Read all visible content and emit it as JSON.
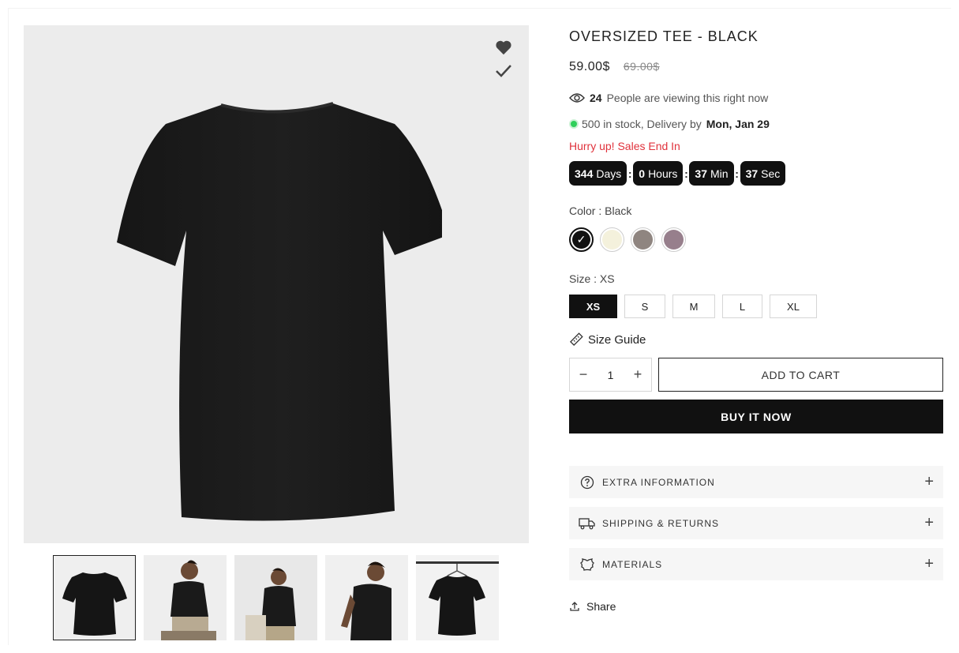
{
  "product": {
    "title": "OVERSIZED TEE - BLACK",
    "price": "59.00$",
    "compare_price": "69.00$"
  },
  "social_proof": {
    "viewers_count": "24",
    "viewers_text": "People are viewing this right now"
  },
  "stock": {
    "text": "500 in stock, Delivery by",
    "date": "Mon, Jan 29"
  },
  "countdown": {
    "hurry_text": "Hurry up! Sales End In",
    "days_value": "344",
    "days_label": "Days",
    "hours_value": "0",
    "hours_label": "Hours",
    "min_value": "37",
    "min_label": "Min",
    "sec_value": "37",
    "sec_label": "Sec",
    "separator": ":"
  },
  "color": {
    "label": "Color : Black",
    "options": [
      {
        "name": "Black",
        "hex": "#111111",
        "selected": true
      },
      {
        "name": "Cream",
        "hex": "#f4f1dc",
        "selected": false
      },
      {
        "name": "Taupe",
        "hex": "#8f8580",
        "selected": false
      },
      {
        "name": "Mauve",
        "hex": "#977f8c",
        "selected": false
      }
    ]
  },
  "size": {
    "label": "Size : XS",
    "options": [
      "XS",
      "S",
      "M",
      "L",
      "XL"
    ],
    "selected": "XS"
  },
  "size_guide": "Size Guide",
  "quantity": {
    "minus": "−",
    "value": "1",
    "plus": "+"
  },
  "buttons": {
    "add_to_cart": "ADD TO CART",
    "buy_now": "BUY IT NOW"
  },
  "accordion": {
    "extra": "EXTRA INFORMATION",
    "shipping": "SHIPPING & RETURNS",
    "materials": "MATERIALS",
    "toggle": "+"
  },
  "share": "Share",
  "thumbnails": [
    "Shirt back",
    "Model seated",
    "Model standing",
    "Model side",
    "Shirt on hanger"
  ],
  "icons": {
    "wishlist": "heart-icon",
    "compare": "check-icon",
    "viewers": "eye-icon",
    "size_guide": "ruler-icon",
    "extra": "question-circle-icon",
    "shipping": "truck-icon",
    "materials": "fabric-icon",
    "share": "share-icon"
  },
  "colors": {
    "accent_red": "#e0323c",
    "stock_green": "#2fcf5a",
    "primary_dark": "#111111"
  }
}
